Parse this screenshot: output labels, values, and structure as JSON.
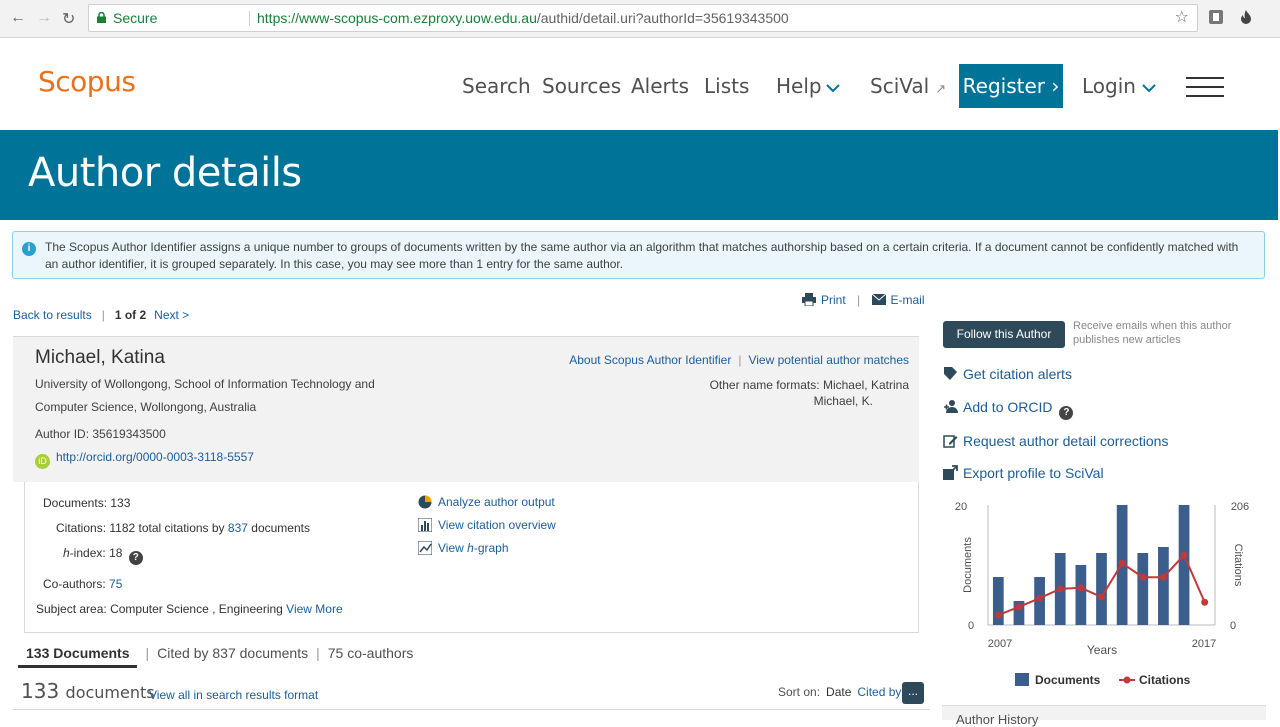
{
  "browser": {
    "secure_label": "Secure",
    "url_host": "https://www-scopus-com.ezproxy.uow.edu.au",
    "url_path": "/authid/detail.uri?authorId=35619343500"
  },
  "header": {
    "logo": "Scopus",
    "nav": {
      "search": "Search",
      "sources": "Sources",
      "alerts": "Alerts",
      "lists": "Lists",
      "help": "Help",
      "scival": "SciVal"
    },
    "register": "Register",
    "login": "Login",
    "colors": {
      "brand": "#e9711c",
      "accent": "#007398"
    }
  },
  "banner": {
    "title": "Author details"
  },
  "info": {
    "text": "The Scopus Author Identifier assigns a unique number to groups of documents written by the same author via an algorithm that matches authorship based on a certain criteria. If a document cannot be confidently matched with an author identifier, it is grouped separately. In this case, you may see more than 1 entry for the same author."
  },
  "pager": {
    "back": "Back to results",
    "position": "1 of 2",
    "next": "Next >"
  },
  "actions": {
    "print": "Print",
    "email": "E-mail"
  },
  "author": {
    "name": "Michael, Katina",
    "affiliation_line1": "University of Wollongong, School of Information Technology and",
    "affiliation_line2": "Computer Science, Wollongong, Australia",
    "author_id": "Author ID: 35619343500",
    "orcid": "http://orcid.org/0000-0003-3118-5557",
    "about_link": "About Scopus Author Identifier",
    "potential_link": "View potential author matches",
    "other_label": "Other name formats:",
    "other_1": "Michael, Katrina",
    "other_2": "Michael, K."
  },
  "metrics": {
    "documents_label": "Documents:",
    "documents": "133",
    "citations_label": "Citations:",
    "citations_pre": "1182 total citations by",
    "citations_docs": "837",
    "citations_post": "documents",
    "hindex_label_h": "h",
    "hindex_label_rest": "-index:",
    "hindex": "18",
    "coauthors_label": "Co-authors:",
    "coauthors": "75",
    "subject_label": "Subject area:",
    "subjects": "Computer Science ,  Engineering",
    "view_more": "View More"
  },
  "tools": {
    "analyze": "Analyze author output",
    "citation_overview": "View citation overview",
    "hgraph_pre": "View ",
    "hgraph_h": "h",
    "hgraph_post": "-graph"
  },
  "tabs": {
    "documents": "133 Documents",
    "cited_by": "Cited by 837 documents",
    "coauthors": "75 co-authors"
  },
  "results": {
    "count": "133",
    "unit": "documents",
    "view_all": "View all in search results format",
    "sort_label": "Sort on:",
    "sort_date": "Date",
    "sort_cited": "Cited by",
    "more": "..."
  },
  "sidebar": {
    "follow": "Follow this Author",
    "follow_note": "Receive emails when this author publishes new articles",
    "citation_alerts": "Get citation alerts",
    "add_orcid": "Add to ORCID",
    "request_corrections": "Request author detail corrections",
    "export": "Export profile to SciVal",
    "history_partial": "Author History"
  },
  "chart_data": {
    "type": "bar",
    "x": [
      2007,
      2008,
      2009,
      2010,
      2011,
      2012,
      2013,
      2014,
      2015,
      2016,
      2017
    ],
    "series": [
      {
        "name": "Documents",
        "kind": "bar",
        "axis": "left",
        "color": "#3b5e8c",
        "values": [
          8,
          4,
          8,
          12,
          10,
          12,
          20,
          12,
          13,
          20,
          0
        ]
      },
      {
        "name": "Citations",
        "kind": "line",
        "axis": "right",
        "color": "#c0393b",
        "values": [
          17,
          31,
          46,
          62,
          64,
          48,
          106,
          82,
          82,
          120,
          39
        ]
      }
    ],
    "xlabel": "Years",
    "ylabel_left": "Documents",
    "ylabel_right": "Citations",
    "ylim_left": [
      0,
      20
    ],
    "ylim_right": [
      0,
      206
    ],
    "xtick_labels": [
      "2007",
      "2017"
    ],
    "ytick_left": [
      "20",
      "0"
    ],
    "ytick_right": [
      "206",
      "0"
    ],
    "legend_position": "bottom"
  }
}
